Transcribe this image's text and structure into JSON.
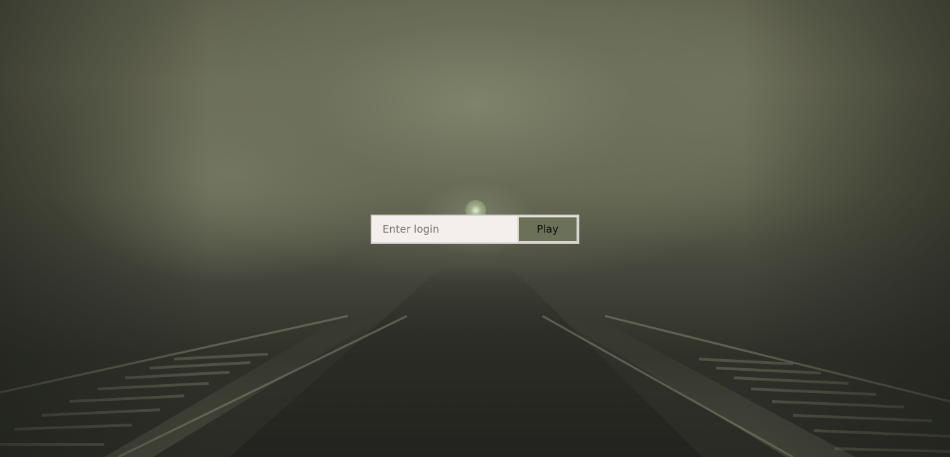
{
  "login": {
    "placeholder": "Enter login",
    "value": "",
    "play_label": "Play"
  },
  "colors": {
    "button_background": "#6b7158",
    "input_background": "#f4efec",
    "border": "#d8d4cf",
    "scene_fog": "#6a6c56",
    "scene_ground": "#2a2b25"
  }
}
